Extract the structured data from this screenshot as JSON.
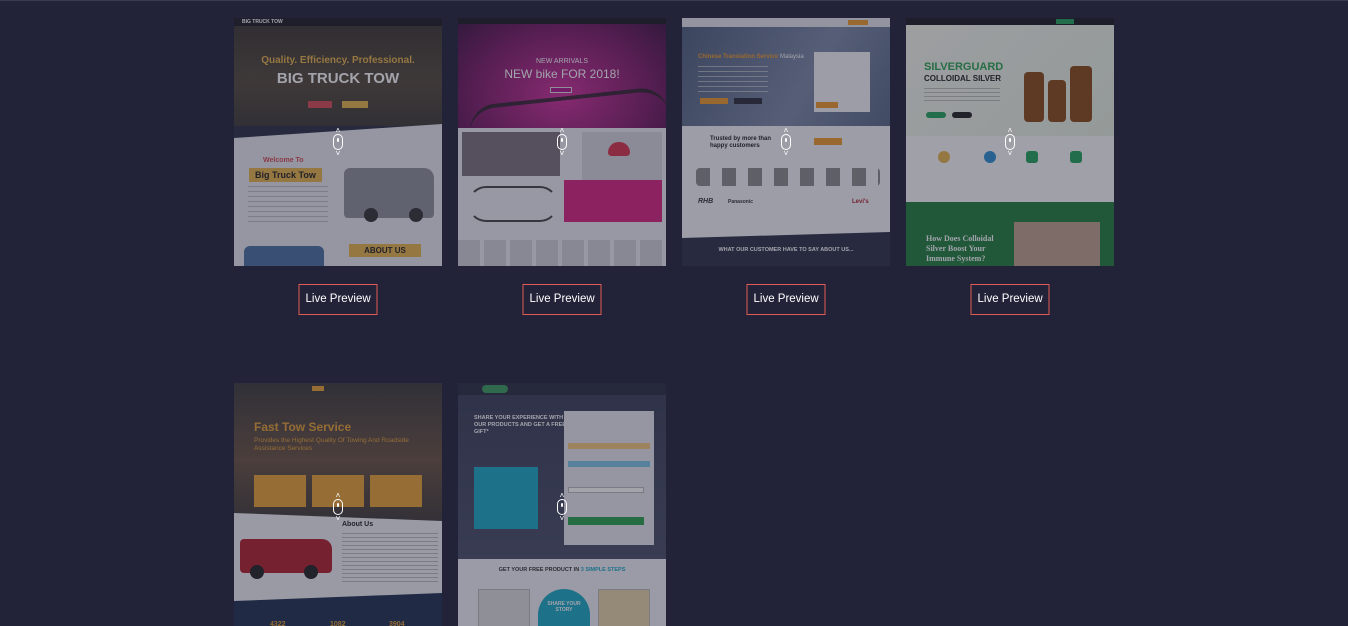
{
  "cards": [
    {
      "button": "Live Preview",
      "thumb": {
        "brand": "BIG TRUCK TOW",
        "tagline": "Quality. Efficiency. Professional.",
        "headline": "BIG TRUCK TOW",
        "welcome": "Welcome To",
        "welcome_brand": "Big Truck Tow",
        "cta": "ABOUT US"
      }
    },
    {
      "button": "Live Preview",
      "thumb": {
        "kicker": "NEW ARRIVALS",
        "headline": "NEW bike FOR 2018!"
      }
    },
    {
      "button": "Live Preview",
      "thumb": {
        "title_a": "Chinese Translation Service",
        "title_b": "Malaysia",
        "trusted_a": "Trusted by more than",
        "trusted_b": "happy customers",
        "logos": [
          "RHB",
          "Panasonic",
          "Levi's"
        ],
        "customers": "WHAT OUR CUSTOMER HAVE TO SAY ABOUT US..."
      }
    },
    {
      "button": "Live Preview",
      "thumb": {
        "headline_a": "SILVERGUARD",
        "headline_b": "COLLOIDAL SILVER",
        "question": "How Does Colloidal Silver Boost Your Immune System?"
      }
    },
    {
      "button": "",
      "thumb": {
        "headline": "Fast Tow Service",
        "sub": "Provides the Highest Quality Of Towing And Roadside Assistance Services",
        "about": "About Us",
        "stats": [
          "4322",
          "1082",
          "3904"
        ]
      }
    },
    {
      "button": "",
      "thumb": {
        "headline": "SHARE YOUR EXPERIENCE WITH OUR PRODUCTS AND GET A FREE GIFT*",
        "steps_a": "GET YOUR FREE PRODUCT IN",
        "steps_b": "3 SIMPLE STEPS",
        "stamp": "SHARE YOUR STORY"
      }
    }
  ],
  "colors": {
    "background": "#222338",
    "button_border": "#e15c55",
    "button_text": "#ffffff"
  },
  "icons": [
    "mouse-scroll-icon"
  ]
}
